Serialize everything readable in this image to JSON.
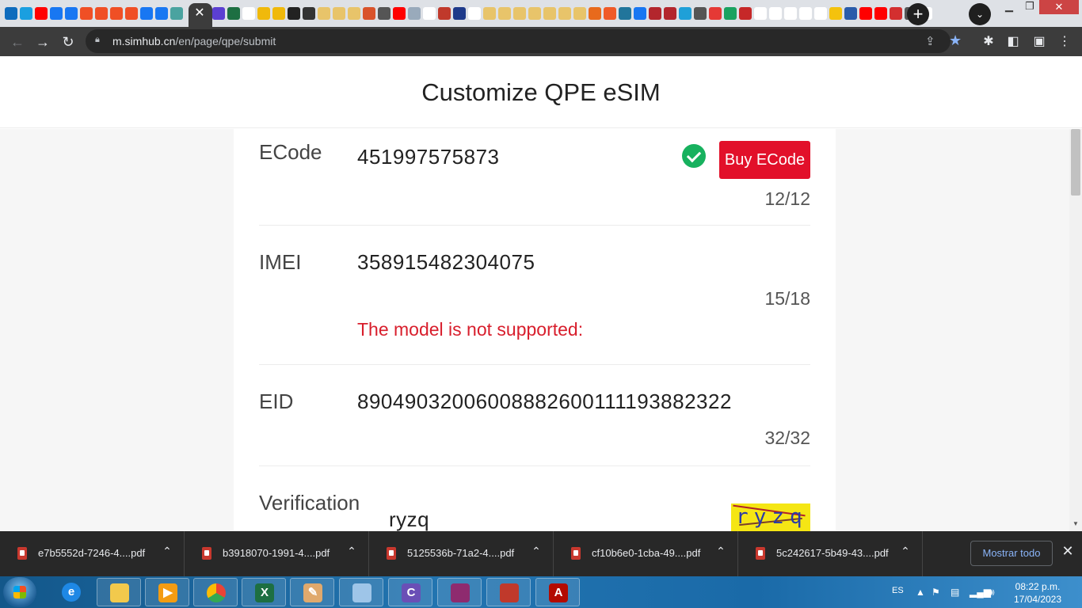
{
  "browser": {
    "url_host": "m.simhub.cn",
    "url_path": "/en/page/qpe/submit",
    "close_glyph": "✕",
    "new_tab_glyph": "+",
    "tab_search_glyph": "⌄"
  },
  "page": {
    "title": "Customize QPE eSIM"
  },
  "form": {
    "ecode": {
      "label": "ECode",
      "value": "451997575873",
      "counter": "12/12",
      "buy_label": "Buy ECode"
    },
    "imei": {
      "label": "IMEI",
      "value": "358915482304075",
      "counter": "15/18",
      "error": "The model is not supported:"
    },
    "eid": {
      "label": "EID",
      "value": "89049032006008882600111193882322",
      "counter": "32/32"
    },
    "verification": {
      "label": "Verification",
      "value": "ryzq",
      "captcha_text": "ryzq"
    }
  },
  "downloads": {
    "items": [
      {
        "name": "e7b5552d-7246-4....pdf"
      },
      {
        "name": "b3918070-1991-4....pdf"
      },
      {
        "name": "5125536b-71a2-4....pdf"
      },
      {
        "name": "cf10b6e0-1cba-49....pdf"
      },
      {
        "name": "5c242617-5b49-43....pdf"
      }
    ],
    "show_all": "Mostrar todo"
  },
  "taskbar": {
    "language": "ES",
    "time": "08:22 p.m.",
    "date": "17/04/2023"
  },
  "colors": {
    "accent_red": "#e2102a",
    "success_green": "#17b15e",
    "error_red": "#d81e2c"
  }
}
